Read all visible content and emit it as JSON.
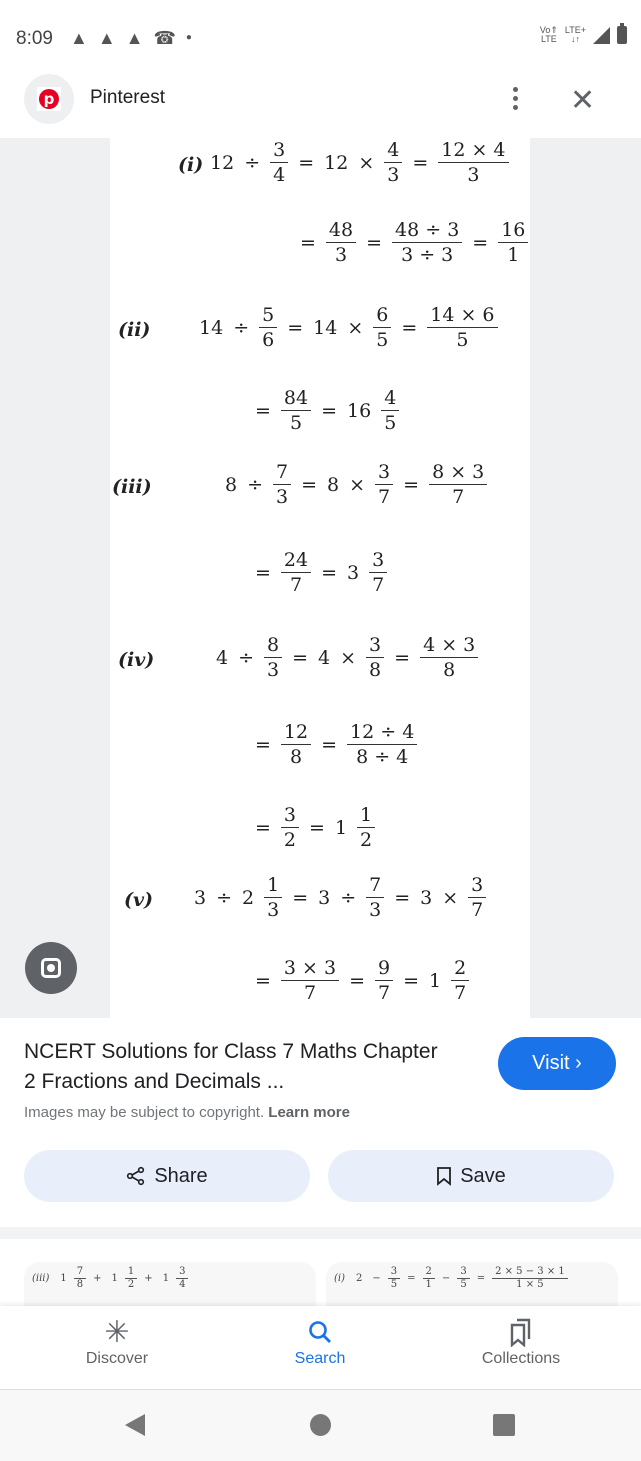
{
  "status_bar": {
    "time": "8:09",
    "notification_icons": [
      "snapchat-icon",
      "snapchat-icon",
      "snapchat-icon",
      "missed-call-icon",
      "dot-icon"
    ],
    "volte_top": "Vo⇑",
    "volte_bottom": "LTE",
    "lte_label": "LTE+",
    "lte_arrows": "↓↑"
  },
  "header": {
    "site_name": "Pinterest",
    "logo_letter": "p",
    "brand_color": "#e60023"
  },
  "image": {
    "problems": [
      {
        "label": "(i)",
        "lines": [
          [
            "12",
            "÷",
            {
              "n": "3",
              "d": "4"
            },
            "=",
            "12",
            "×",
            {
              "n": "4",
              "d": "3"
            },
            "=",
            {
              "n": "12 × 4",
              "d": "3"
            }
          ],
          [
            "=",
            {
              "n": "48",
              "d": "3"
            },
            "=",
            {
              "n": "48 ÷ 3",
              "d": "3 ÷ 3"
            },
            "=",
            {
              "n": "16",
              "d": "1"
            }
          ]
        ]
      },
      {
        "label": "(ii)",
        "lines": [
          [
            "14",
            "÷",
            {
              "n": "5",
              "d": "6"
            },
            "=",
            "14",
            "×",
            {
              "n": "6",
              "d": "5"
            },
            "=",
            {
              "n": "14 × 6",
              "d": "5"
            }
          ],
          [
            "=",
            {
              "n": "84",
              "d": "5"
            },
            "=",
            "16",
            {
              "n": "4",
              "d": "5"
            }
          ]
        ]
      },
      {
        "label": "(iii)",
        "lines": [
          [
            "8",
            "÷",
            {
              "n": "7",
              "d": "3"
            },
            "=",
            "8",
            "×",
            {
              "n": "3",
              "d": "7"
            },
            "=",
            {
              "n": "8 × 3",
              "d": "7"
            }
          ],
          [
            "=",
            {
              "n": "24",
              "d": "7"
            },
            "=",
            "3",
            {
              "n": "3",
              "d": "7"
            }
          ]
        ]
      },
      {
        "label": "(iv)",
        "lines": [
          [
            "4",
            "÷",
            {
              "n": "8",
              "d": "3"
            },
            "=",
            "4",
            "×",
            {
              "n": "3",
              "d": "8"
            },
            "=",
            {
              "n": "4 × 3",
              "d": "8"
            }
          ],
          [
            "=",
            {
              "n": "12",
              "d": "8"
            },
            "=",
            {
              "n": "12 ÷ 4",
              "d": "8 ÷ 4"
            }
          ],
          [
            "=",
            {
              "n": "3",
              "d": "2"
            },
            "=",
            "1",
            {
              "n": "1",
              "d": "2"
            }
          ]
        ]
      },
      {
        "label": "(v)",
        "lines": [
          [
            "3",
            "÷",
            "2",
            {
              "n": "1",
              "d": "3"
            },
            "=",
            "3",
            "÷",
            {
              "n": "7",
              "d": "3"
            },
            "=",
            "3",
            "×",
            {
              "n": "3",
              "d": "7"
            }
          ],
          [
            "=",
            {
              "n": "3 × 3",
              "d": "7"
            },
            "=",
            {
              "n": "9",
              "d": "7"
            },
            "=",
            "1",
            {
              "n": "2",
              "d": "7"
            }
          ]
        ]
      }
    ]
  },
  "result": {
    "title": "NCERT Solutions for Class 7 Maths Chapter 2 Fractions and Decimals ...",
    "copyright_text": "Images may be subject to copyright.",
    "learn_more": "Learn more",
    "visit_label": "Visit ›",
    "share_label": "Share",
    "save_label": "Save",
    "accent_color": "#1a73e8"
  },
  "related": [
    {
      "label": "(iii)",
      "line": [
        "1",
        {
          "n": "7",
          "d": "8"
        },
        "+",
        "1",
        {
          "n": "1",
          "d": "2"
        },
        "+",
        "1",
        {
          "n": "3",
          "d": "4"
        }
      ]
    },
    {
      "label": "(i)",
      "line": [
        "2",
        "−",
        {
          "n": "3",
          "d": "5"
        },
        "=",
        {
          "n": "2",
          "d": "1"
        },
        "−",
        {
          "n": "3",
          "d": "5"
        },
        "=",
        {
          "n": "2 × 5 − 3 × 1",
          "d": "1 × 5"
        }
      ]
    }
  ],
  "bottom_nav": {
    "items": [
      {
        "label": "Discover",
        "icon": "discover-icon",
        "active": false
      },
      {
        "label": "Search",
        "icon": "search-icon",
        "active": true
      },
      {
        "label": "Collections",
        "icon": "collections-icon",
        "active": false
      }
    ]
  }
}
